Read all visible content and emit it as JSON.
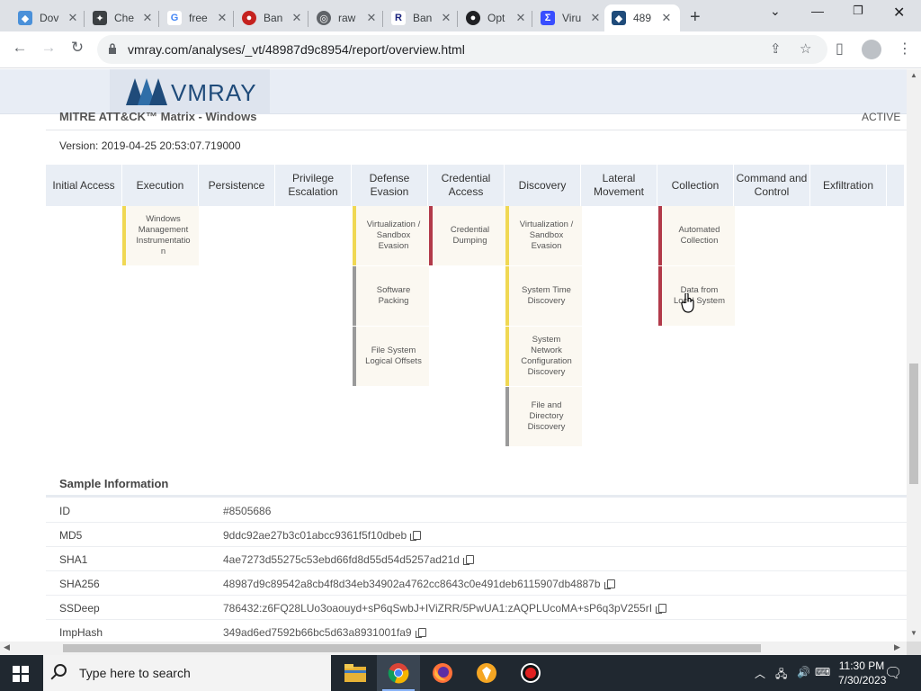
{
  "browser": {
    "tabs": [
      {
        "title": "Dov",
        "icon": "vmray-favicon-icon",
        "color": "#4a90d9"
      },
      {
        "title": "Che",
        "icon": "cog-favicon-icon",
        "color": "#3c4043"
      },
      {
        "title": "free",
        "icon": "google-favicon-icon",
        "color": "#4285f4"
      },
      {
        "title": "Ban",
        "icon": "circle-favicon-icon",
        "color": "#c5221f"
      },
      {
        "title": "raw",
        "icon": "globe-favicon-icon",
        "color": "#5f6368"
      },
      {
        "title": "Ban",
        "icon": "r-favicon-icon",
        "color": "#1a237e"
      },
      {
        "title": "Opt",
        "icon": "github-favicon-icon",
        "color": "#202124"
      },
      {
        "title": "Viru",
        "icon": "virustotal-favicon-icon",
        "color": "#394eff"
      },
      {
        "title": "489",
        "icon": "vmray-favicon-icon",
        "color": "#1f4b7a"
      }
    ],
    "url": "vmray.com/analyses/_vt/48987d9c8954/report/overview.html"
  },
  "header": {
    "logo_text": "VMRAY"
  },
  "mitre": {
    "title": "MITRE ATT&CK™ Matrix - Windows",
    "status": "ACTIVE",
    "version": "Version: 2019-04-25 20:53:07.719000",
    "tactics": [
      "Initial Access",
      "Execution",
      "Persistence",
      "Privilege Escalation",
      "Defense Evasion",
      "Credential Access",
      "Discovery",
      "Lateral Movement",
      "Collection",
      "Command and Control",
      "Exfiltration"
    ],
    "techniques": {
      "execution": [
        "Windows Management Instrumentatio n"
      ],
      "defense_evasion": [
        "Virtualization / Sandbox Evasion",
        "Software Packing",
        "File System Logical Offsets"
      ],
      "credential_access": [
        "Credential Dumping"
      ],
      "discovery": [
        "Virtualization / Sandbox Evasion",
        "System Time Discovery",
        "System Network Configuration Discovery",
        "File and Directory Discovery"
      ],
      "collection": [
        "Automated Collection",
        "Data from Local System"
      ]
    },
    "colors": {
      "yellow": "#f0d853",
      "red": "#b23a4a",
      "gray": "#9a9a9a"
    }
  },
  "sample": {
    "title": "Sample Information",
    "rows": [
      {
        "key": "ID",
        "value": "#8505686",
        "copy": false
      },
      {
        "key": "MD5",
        "value": "9ddc92ae27b3c01abcc9361f5f10dbeb",
        "copy": true
      },
      {
        "key": "SHA1",
        "value": "4ae7273d55275c53ebd66fd8d55d54d5257ad21d",
        "copy": true
      },
      {
        "key": "SHA256",
        "value": "48987d9c89542a8cb4f8d34eb34902a4762cc8643c0e491deb6115907db4887b",
        "copy": true
      },
      {
        "key": "SSDeep",
        "value": "786432:z6FQ28LUo3oaouyd+sP6qSwbJ+IViZRR/5PwUA1:zAQPLUcoMA+sP6q3pV255rI",
        "copy": true
      },
      {
        "key": "ImpHash",
        "value": "349ad6ed7592b66bc5d63a8931001fa9",
        "copy": true
      }
    ]
  },
  "taskbar": {
    "search_placeholder": "Type here to search",
    "time": "11:30 PM",
    "date": "7/30/2023"
  }
}
